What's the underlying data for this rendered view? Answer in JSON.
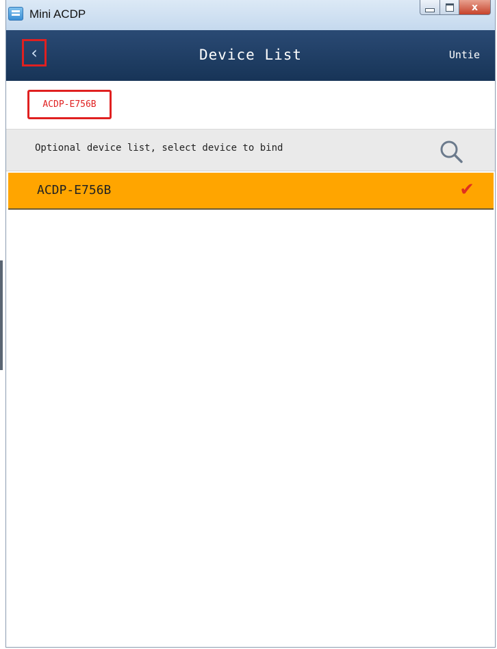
{
  "window": {
    "title": "Mini ACDP",
    "controls": {
      "close_glyph": "x"
    }
  },
  "header": {
    "back_glyph": "‹",
    "title": "Device List",
    "untie_label": "Untie"
  },
  "current_device": "ACDP-E756B",
  "search": {
    "text": "Optional device list, select device to bind"
  },
  "devices": [
    {
      "name": "ACDP-E756B",
      "selected": true,
      "check_glyph": "✔"
    }
  ],
  "colors": {
    "header_bg": "#1e3d63",
    "selected_row": "#ffa500",
    "highlight_red": "#e02020",
    "check_red": "#e0301e",
    "search_bar_bg": "#eaeaea"
  },
  "icons": [
    "app-icon",
    "minimize-icon",
    "maximize-icon",
    "close-icon",
    "back-icon",
    "search-icon",
    "checkmark-icon"
  ]
}
